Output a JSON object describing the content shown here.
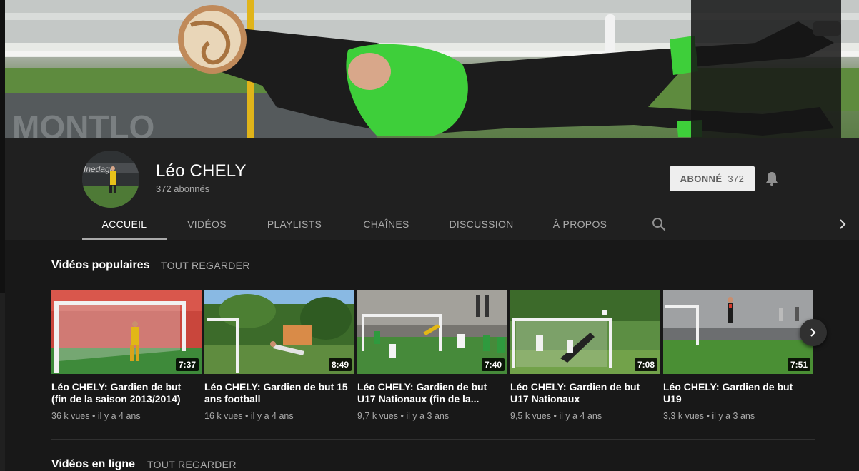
{
  "channel": {
    "name": "Léo CHELY",
    "subscribers": "372 abonnés"
  },
  "subscribe": {
    "label": "ABONNÉ",
    "count": "372"
  },
  "tabs": [
    {
      "label": "ACCUEIL",
      "active": true
    },
    {
      "label": "VIDÉOS",
      "active": false
    },
    {
      "label": "PLAYLISTS",
      "active": false
    },
    {
      "label": "CHAÎNES",
      "active": false
    },
    {
      "label": "DISCUSSION",
      "active": false
    },
    {
      "label": "À PROPOS",
      "active": false
    }
  ],
  "sections": {
    "popular": {
      "title": "Vidéos populaires",
      "link": "TOUT REGARDER"
    },
    "online": {
      "title": "Vidéos en ligne",
      "link": "TOUT REGARDER"
    }
  },
  "videos": [
    {
      "title": "Léo CHELY: Gardien de but (fin de la saison 2013/2014)",
      "views": "36 k vues",
      "age": "il y a 4 ans",
      "duration": "7:37"
    },
    {
      "title": "Léo CHELY: Gardien de but 15 ans football",
      "views": "16 k vues",
      "age": "il y a 4 ans",
      "duration": "8:49"
    },
    {
      "title": "Léo CHELY: Gardien de but U17 Nationaux (fin de la...",
      "views": "9,7 k vues",
      "age": "il y a 3 ans",
      "duration": "7:40"
    },
    {
      "title": "Léo CHELY: Gardien de but U17 Nationaux",
      "views": "9,5 k vues",
      "age": "il y a 4 ans",
      "duration": "7:08"
    },
    {
      "title": "Léo CHELY: Gardien de but U19",
      "views": "3,3 k vues",
      "age": "il y a 3 ans",
      "duration": "7:51"
    }
  ],
  "meta_separator": "•",
  "icons": {
    "bell": "bell-icon",
    "search": "search-icon",
    "tabs_next": "chevron-right-icon",
    "carousel_next": "chevron-right-icon"
  },
  "colors": {
    "background": "#181818",
    "header": "#202020",
    "subscribe_bg": "#eeeeee",
    "muted_text": "#aaaaaa",
    "jersey_green": "#3ecf3a"
  }
}
